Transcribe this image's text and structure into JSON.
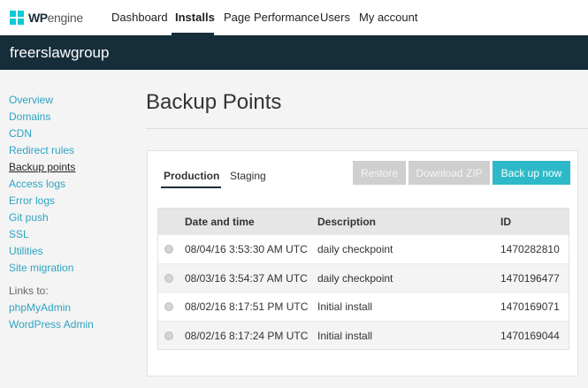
{
  "brand": {
    "wp": "WP",
    "engine": "engine"
  },
  "nav": {
    "items": [
      {
        "label": "Dashboard"
      },
      {
        "label": "Installs"
      },
      {
        "label": "Page Performance"
      },
      {
        "label": "Users"
      },
      {
        "label": "My account"
      }
    ],
    "active": "Installs"
  },
  "site": {
    "name": "freerslawgroup"
  },
  "sidebar": {
    "items": [
      {
        "label": "Overview"
      },
      {
        "label": "Domains"
      },
      {
        "label": "CDN"
      },
      {
        "label": "Redirect rules"
      },
      {
        "label": "Backup points"
      },
      {
        "label": "Access logs"
      },
      {
        "label": "Error logs"
      },
      {
        "label": "Git push"
      },
      {
        "label": "SSL"
      },
      {
        "label": "Utilities"
      },
      {
        "label": "Site migration"
      }
    ],
    "current": "Backup points",
    "links_heading": "Links to:",
    "links": [
      {
        "label": "phpMyAdmin"
      },
      {
        "label": "WordPress Admin"
      }
    ]
  },
  "main": {
    "title": "Backup Points",
    "tabs": [
      {
        "label": "Production"
      },
      {
        "label": "Staging"
      }
    ],
    "active_tab": "Production",
    "buttons": {
      "restore": "Restore",
      "download_zip": "Download ZIP",
      "backup_now": "Back up now"
    },
    "table": {
      "headers": {
        "date": "Date and time",
        "description": "Description",
        "id": "ID"
      },
      "rows": [
        {
          "date": "08/04/16 3:53:30 AM UTC",
          "description": "daily checkpoint",
          "id": "1470282810"
        },
        {
          "date": "08/03/16 3:54:37 AM UTC",
          "description": "daily checkpoint",
          "id": "1470196477"
        },
        {
          "date": "08/02/16 8:17:51 PM UTC",
          "description": "Initial install",
          "id": "1470169071"
        },
        {
          "date": "08/02/16 8:17:24 PM UTC",
          "description": "Initial install",
          "id": "1470169044"
        }
      ]
    }
  },
  "colors": {
    "accent": "#2db9c8",
    "link": "#2da3c1",
    "dark_bar": "#162d3a",
    "disabled_button": "#cfcfcf"
  }
}
